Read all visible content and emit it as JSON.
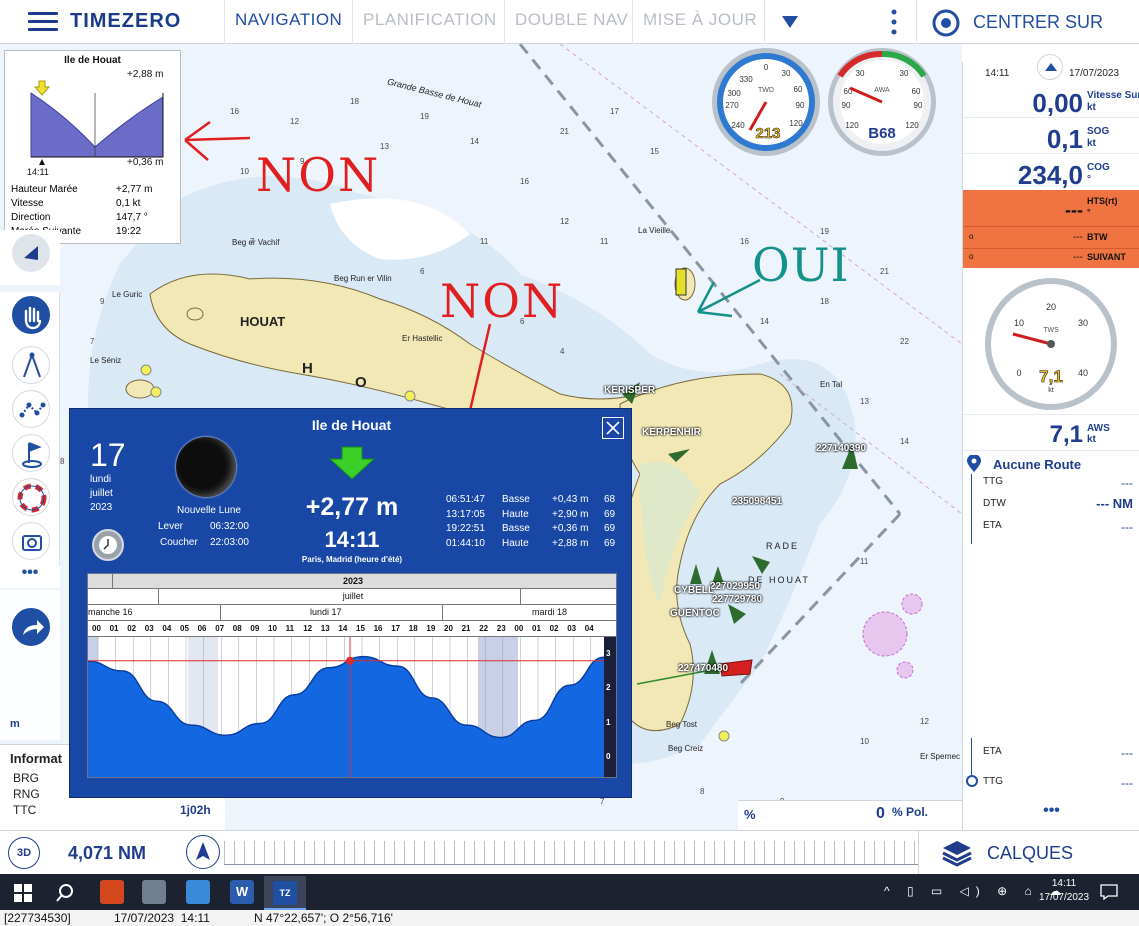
{
  "app": {
    "brand": "TIMEZERO"
  },
  "topnav": {
    "tabs": [
      "NAVIGATION",
      "PLANIFICATION",
      "DOUBLE NAV",
      "MISE À JOUR"
    ],
    "center_label": "CENTRER SUR"
  },
  "tide_widget": {
    "title": "Ile de Houat",
    "max_height": "+2,88 m",
    "min_height": "+0,36 m",
    "time": "14:11",
    "rows": [
      {
        "label": "Hauteur Marée",
        "value": "+2,77 m"
      },
      {
        "label": "Vitesse",
        "value": "0,1 kt"
      },
      {
        "label": "Direction",
        "value": "147,7 °"
      },
      {
        "label": "Marée Suivante",
        "value": "19:22"
      }
    ]
  },
  "annotations": {
    "non1": "NON",
    "non2": "NON",
    "oui": "OUI"
  },
  "chart_labels": {
    "houat_island": "HOUAT",
    "houat_letter": "H",
    "houat_letter2": "O",
    "beg_er_vachif": "Beg er Vachif",
    "beg_run_er_vilin": "Beg Run er Vilin",
    "er_hastellic": "Er Hastellic",
    "le_guric": "Le Guric",
    "le_seniz": "Le Séniz",
    "la_vieille": "La Vieille",
    "en_tal": "En Tal",
    "rade": "RADE",
    "de_houat": "DE HOUAT",
    "beg_creiz": "Beg Creiz",
    "beg_tost": "Beg Tost",
    "er_spernec": "Er Spernec",
    "grande_basse": "Grande Basse de Houat",
    "targets": [
      "KERISPER",
      "KERPENHIR",
      "227140390",
      "235098451",
      "227029950",
      "227729780",
      "CYBELL",
      "GUENTOC",
      "227470480"
    ]
  },
  "gauges": {
    "twd": {
      "label": "TWD",
      "value": "213",
      "ticks": [
        "330",
        "300",
        "270",
        "240",
        "0",
        "30",
        "60",
        "90",
        "120"
      ]
    },
    "awa": {
      "label": "AWA",
      "value": "B68",
      "ticks": [
        "30",
        "60",
        "90",
        "120",
        "30",
        "60",
        "90",
        "120"
      ]
    },
    "tws": {
      "label": "TWS",
      "value": "7,1",
      "unit": "kt",
      "ticks": [
        "0",
        "10",
        "20",
        "30",
        "40"
      ]
    }
  },
  "right_panel": {
    "time": "14:11",
    "date": "17/07/2023",
    "rows": [
      {
        "value": "0,00",
        "label": "Vitesse Surf.",
        "unit": "kt"
      },
      {
        "value": "0,1",
        "label": "SOG",
        "unit": "kt"
      },
      {
        "value": "234,0",
        "label": "COG",
        "unit": "°"
      }
    ],
    "hts": {
      "label": "HTS(rt)",
      "value": "---",
      "unit": "°"
    },
    "btw": {
      "label": "BTW",
      "value": "---"
    },
    "suivant": {
      "label": "SUIVANT",
      "value": "---"
    },
    "aws": {
      "value": "7,1",
      "label": "AWS",
      "unit": "kt"
    },
    "route": "Aucune Route",
    "route_rows": [
      {
        "label": "TTG",
        "value": "---"
      },
      {
        "label": "DTW",
        "value": "--- NM"
      },
      {
        "label": "ETA",
        "value": "---"
      }
    ],
    "eta2": {
      "label": "ETA",
      "value": "---"
    },
    "ttg2": {
      "label": "TTG",
      "value": "---"
    },
    "pol": {
      "value": "0",
      "label": "% Pol."
    }
  },
  "left_panel": {
    "info_title": "Informat",
    "rows": [
      "BRG",
      "RNG",
      "TTC"
    ],
    "unit_m": "m",
    "ttc_value": "1j02h"
  },
  "tide_dialog": {
    "title": "Ile de Houat",
    "day_num": "17",
    "day_name": "lundi",
    "month": "juillet",
    "year": "2023",
    "moon_phase": "Nouvelle Lune",
    "moon_rise_label": "Lever",
    "moon_rise": "06:32:00",
    "moon_set_label": "Coucher",
    "moon_set": "22:03:00",
    "height": "+2,77 m",
    "time": "14:11",
    "tz": "Paris, Madrid (heure d'été)",
    "tides": [
      {
        "time": "06:51:47",
        "type": "Basse",
        "height": "+0,43 m",
        "coef": "68"
      },
      {
        "time": "13:17:05",
        "type": "Haute",
        "height": "+2,90 m",
        "coef": "69"
      },
      {
        "time": "19:22:51",
        "type": "Basse",
        "height": "+0,36 m",
        "coef": "69"
      },
      {
        "time": "01:44:10",
        "type": "Haute",
        "height": "+2,88 m",
        "coef": "69"
      }
    ],
    "timeline_year": "2023",
    "timeline_month": "juillet",
    "days": [
      "manche 16",
      "lundi 17",
      "mardi 18"
    ],
    "hours": [
      "00",
      "01",
      "02",
      "03",
      "04",
      "05",
      "06",
      "07",
      "08",
      "09",
      "10",
      "11",
      "12",
      "13",
      "14",
      "15",
      "16",
      "17",
      "18",
      "19",
      "20",
      "21",
      "22",
      "23",
      "00",
      "01",
      "02",
      "03",
      "04"
    ],
    "y_ticks": [
      "3",
      "2",
      "1",
      "0"
    ]
  },
  "chart_data": {
    "type": "area",
    "title": "Ile de Houat",
    "x_unit": "hours since 16 Jul 23:00",
    "x": [
      0,
      2,
      4,
      6,
      8,
      10,
      12,
      14,
      16,
      18,
      20,
      22,
      24,
      26,
      28,
      30
    ],
    "y": [
      2.75,
      2.45,
      1.5,
      0.75,
      0.43,
      0.8,
      1.7,
      2.55,
      2.9,
      2.6,
      1.6,
      0.75,
      0.36,
      0.9,
      2.0,
      2.88
    ],
    "ylim": [
      0,
      3.2
    ]
  },
  "bottom": {
    "mode": "3D",
    "distance": "4,071 NM",
    "layers": "CALQUES",
    "percent": "%"
  },
  "taskbar": {
    "time": "14:11",
    "date": "17/07/2023"
  },
  "statusbar": {
    "id": "[227734530]",
    "datetime": "17/07/2023  14:11",
    "position": "N 47°22,657'; O 2°56,716'"
  }
}
